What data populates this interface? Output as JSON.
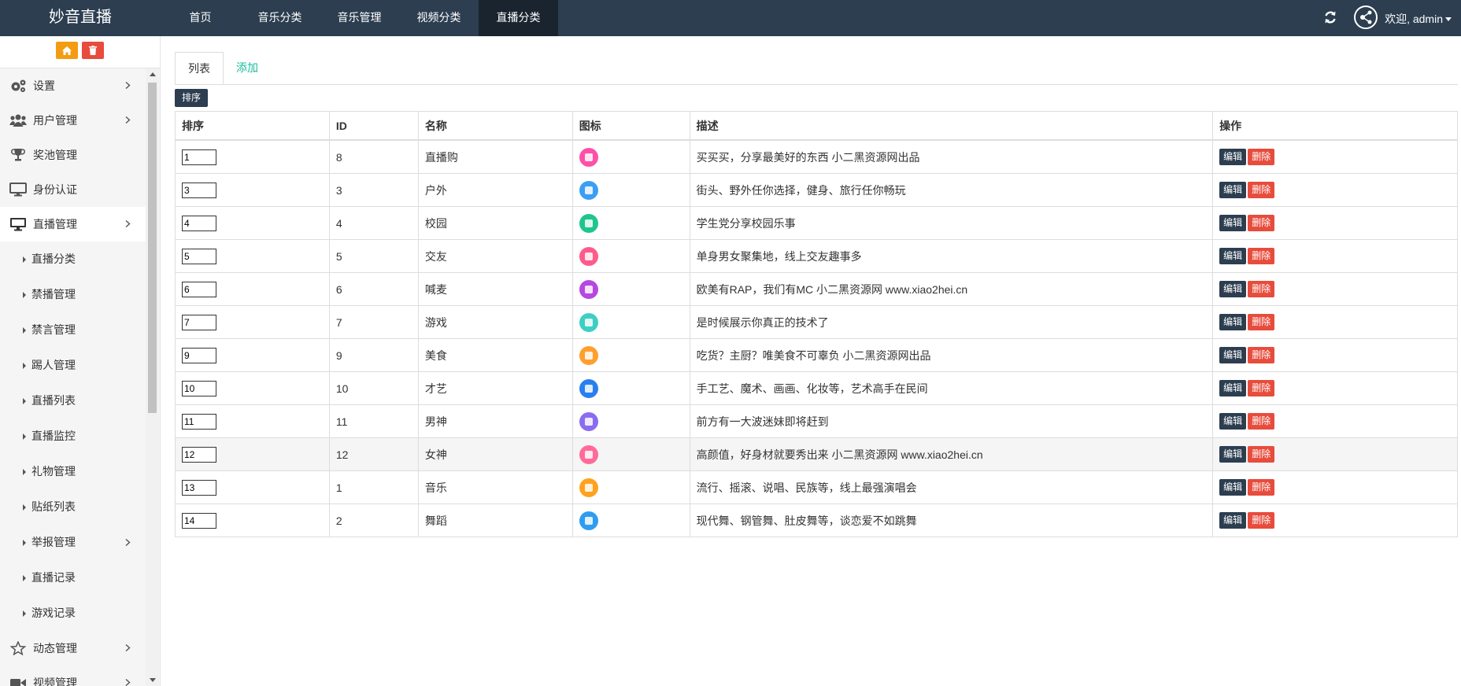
{
  "header": {
    "brand": "妙音直播",
    "nav": [
      {
        "label": "首页",
        "active": false
      },
      {
        "label": "音乐分类",
        "active": false
      },
      {
        "label": "音乐管理",
        "active": false
      },
      {
        "label": "视频分类",
        "active": false
      },
      {
        "label": "直播分类",
        "active": true
      }
    ],
    "welcome": "欢迎, admin"
  },
  "sidebar": {
    "actions": [
      {
        "icon": "home-icon",
        "color": "#f39c12"
      },
      {
        "icon": "trash-icon",
        "color": "#e74c3c"
      }
    ],
    "items": [
      {
        "label": "设置",
        "icon": "gears-icon",
        "has_children": true
      },
      {
        "label": "用户管理",
        "icon": "users-icon",
        "has_children": true
      },
      {
        "label": "奖池管理",
        "icon": "trophy-icon",
        "has_children": false
      },
      {
        "label": "身份认证",
        "icon": "monitor-icon",
        "has_children": false
      },
      {
        "label": "直播管理",
        "icon": "desktop-icon",
        "has_children": true,
        "open": true
      }
    ],
    "sub_items": [
      {
        "label": "直播分类",
        "has_children": false
      },
      {
        "label": "禁播管理",
        "has_children": false
      },
      {
        "label": "禁言管理",
        "has_children": false
      },
      {
        "label": "踢人管理",
        "has_children": false
      },
      {
        "label": "直播列表",
        "has_children": false
      },
      {
        "label": "直播监控",
        "has_children": false
      },
      {
        "label": "礼物管理",
        "has_children": false
      },
      {
        "label": "贴纸列表",
        "has_children": false
      },
      {
        "label": "举报管理",
        "has_children": true
      },
      {
        "label": "直播记录",
        "has_children": false
      },
      {
        "label": "游戏记录",
        "has_children": false
      }
    ],
    "after_items": [
      {
        "label": "动态管理",
        "icon": "star-icon",
        "has_children": true
      },
      {
        "label": "视频管理",
        "icon": "video-icon",
        "has_children": true
      }
    ]
  },
  "main": {
    "tabs": [
      {
        "label": "列表",
        "active": true
      },
      {
        "label": "添加",
        "active": false
      }
    ],
    "sort_button": "排序",
    "columns": [
      "排序",
      "ID",
      "名称",
      "图标",
      "描述",
      "操作"
    ],
    "edit_label": "编辑",
    "delete_label": "删除",
    "rows": [
      {
        "order": "1",
        "id": "8",
        "name": "直播购",
        "icon_color": "#ff4fa8",
        "desc": "买买买，分享最美好的东西 小二黑资源网出品"
      },
      {
        "order": "3",
        "id": "3",
        "name": "户外",
        "icon_color": "#3b9ef5",
        "desc": "街头、野外任你选择，健身、旅行任你畅玩"
      },
      {
        "order": "4",
        "id": "4",
        "name": "校园",
        "icon_color": "#1fc58f",
        "desc": "学生党分享校园乐事"
      },
      {
        "order": "5",
        "id": "5",
        "name": "交友",
        "icon_color": "#ff5a8c",
        "desc": "单身男女聚集地，线上交友趣事多"
      },
      {
        "order": "6",
        "id": "6",
        "name": "喊麦",
        "icon_color": "#b548e0",
        "desc": "欧美有RAP，我们有MC 小二黑资源网 www.xiao2hei.cn"
      },
      {
        "order": "7",
        "id": "7",
        "name": "游戏",
        "icon_color": "#3dcfc4",
        "desc": "是时候展示你真正的技术了"
      },
      {
        "order": "9",
        "id": "9",
        "name": "美食",
        "icon_color": "#ff9f2e",
        "desc": "吃货？主厨？唯美食不可辜负 小二黑资源网出品"
      },
      {
        "order": "10",
        "id": "10",
        "name": "才艺",
        "icon_color": "#2a7ff0",
        "desc": "手工艺、魔术、画画、化妆等，艺术高手在民间"
      },
      {
        "order": "11",
        "id": "11",
        "name": "男神",
        "icon_color": "#8a6cf0",
        "desc": "前方有一大波迷妹即将赶到"
      },
      {
        "order": "12",
        "id": "12",
        "name": "女神",
        "icon_color": "#ff6b9a",
        "desc": "高颜值，好身材就要秀出来 小二黑资源网 www.xiao2hei.cn",
        "highlight": true
      },
      {
        "order": "13",
        "id": "1",
        "name": "音乐",
        "icon_color": "#ffa21f",
        "desc": "流行、摇滚、说唱、民族等，线上最强演唱会"
      },
      {
        "order": "14",
        "id": "2",
        "name": "舞蹈",
        "icon_color": "#2f9cf0",
        "desc": "现代舞、钢管舞、肚皮舞等，谈恋爱不如跳舞"
      }
    ]
  }
}
